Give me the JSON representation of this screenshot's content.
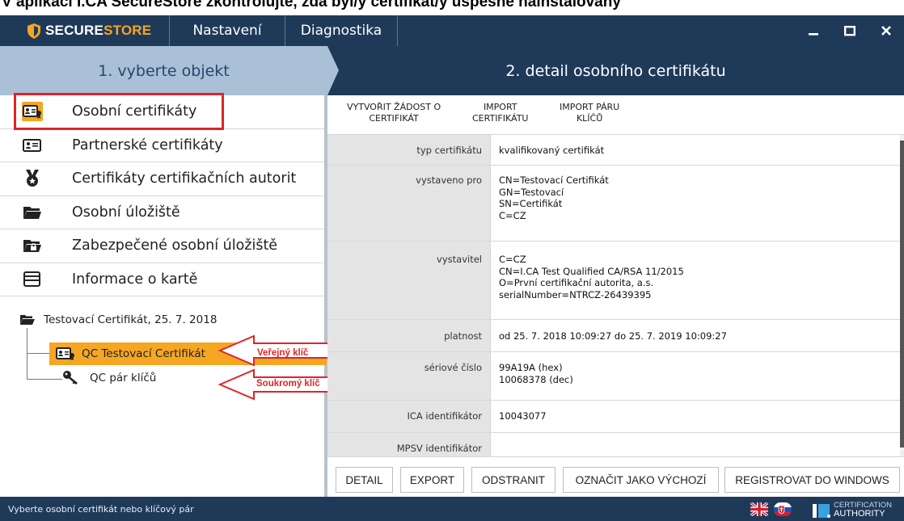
{
  "page_heading": "V aplikaci I.CA SecureStore zkontrolujte, zda byl/y certifikát/y úspěšně nainstalovaný",
  "app": {
    "logo_secure": "SECURE",
    "logo_store": "STORE",
    "menu": [
      {
        "label": "Nastavení"
      },
      {
        "label": "Diagnostika"
      }
    ]
  },
  "steps": {
    "left": "1. vyberte objekt",
    "right": "2. detail osobního certifikátu"
  },
  "nav": [
    {
      "label": "Osobní certifikáty",
      "icon": "id-card-icon",
      "selected": true
    },
    {
      "label": "Partnerské certifikáty",
      "icon": "contact-card-icon"
    },
    {
      "label": "Certifikáty certifikačních autorit",
      "icon": "medal-icon"
    },
    {
      "label": "Osobní úložiště",
      "icon": "folder-icon"
    },
    {
      "label": "Zabezpečené osobní úložiště",
      "icon": "locked-folder-icon"
    },
    {
      "label": "Informace o kartě",
      "icon": "card-icon"
    }
  ],
  "tree": {
    "root": "Testovací Certifikát, 25. 7. 2018",
    "item_certificate": "QC Testovací Certifikát",
    "item_keypair": "QC pár klíčů"
  },
  "annotations": {
    "public_key": "Veřejný klíč",
    "private_key": "Soukromý klíč"
  },
  "toolbar": {
    "create_request": [
      "Vytvořit žádost o",
      "certifikát"
    ],
    "import_certificate": [
      "Import",
      "certifikátu"
    ],
    "import_keypair": [
      "Import páru",
      "klíčů"
    ]
  },
  "details": [
    {
      "label": "typ certifikátu",
      "lines": [
        "kvalifikovaný certifikát"
      ]
    },
    {
      "label": "vystaveno pro",
      "lines": [
        "CN=Testovací Certifikát",
        "GN=Testovací",
        "SN=Certifikát",
        "C=CZ"
      ]
    },
    {
      "label": "vystavitel",
      "lines": [
        "C=CZ",
        "CN=I.CA Test Qualified CA/RSA 11/2015",
        "O=První certifikační autorita, a.s.",
        "serialNumber=NTRCZ-26439395"
      ]
    },
    {
      "label": "platnost",
      "lines": [
        "od 25. 7. 2018 10:09:27 do 25. 7. 2019 10:09:27"
      ]
    },
    {
      "label": "sériové číslo",
      "lines": [
        "99A19A (hex)",
        "10068378 (dec)"
      ]
    },
    {
      "label": "ICA identifikátor",
      "lines": [
        "10043077"
      ]
    },
    {
      "label": "MPSV identifikátor",
      "lines": [
        ""
      ]
    }
  ],
  "footer_buttons": {
    "detail": "Detail",
    "export": "Export",
    "delete": "Odstranit",
    "set_default": "Označit jako výchozí",
    "register_windows": "Registrovat do Windows"
  },
  "status": {
    "text": "Vyberte osobní certifikát nebo klíčový pár",
    "ca_line1": "CERTIFICATION",
    "ca_line2": "AUTHORITY"
  },
  "colors": {
    "navy": "#1f3a59",
    "step_light": "#a9c0d6",
    "accent_orange": "#f5a623",
    "annotation_red": "#e1232a"
  }
}
